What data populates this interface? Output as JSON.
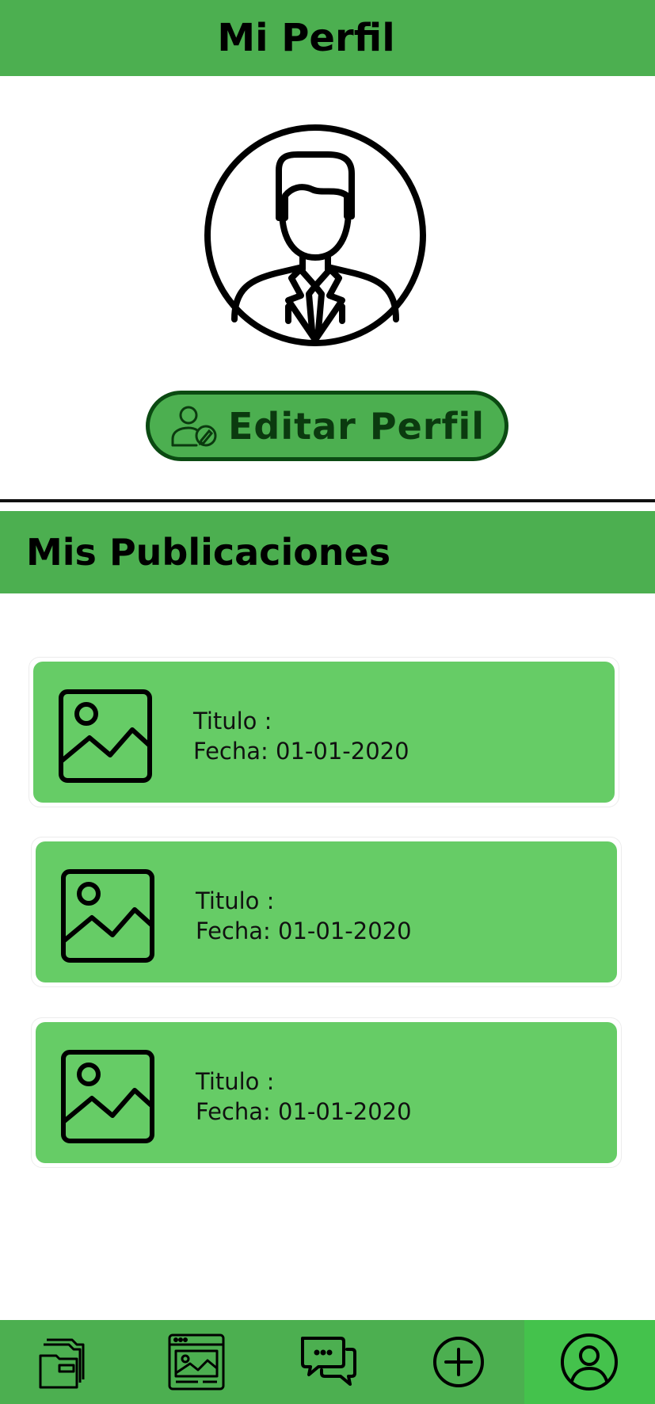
{
  "header": {
    "title": "Mi Perfil"
  },
  "profile": {
    "edit_label": "Editar Perfil"
  },
  "publications": {
    "title": "Mis Publicaciones",
    "items": [
      {
        "title": "Titulo :",
        "date": "Fecha: 01-01-2020"
      },
      {
        "title": "Titulo :",
        "date": "Fecha: 01-01-2020"
      },
      {
        "title": "Titulo :",
        "date": "Fecha: 01-01-2020"
      }
    ]
  },
  "nav": {
    "items": [
      {
        "icon": "folders-icon"
      },
      {
        "icon": "gallery-browser-icon"
      },
      {
        "icon": "chat-icon"
      },
      {
        "icon": "add-circle-icon"
      },
      {
        "icon": "user-profile-icon",
        "active": true
      }
    ]
  },
  "colors": {
    "primary": "#4caf50",
    "card": "#66cc66",
    "active_tab": "#44c24c",
    "button_border": "#0b4a12"
  }
}
